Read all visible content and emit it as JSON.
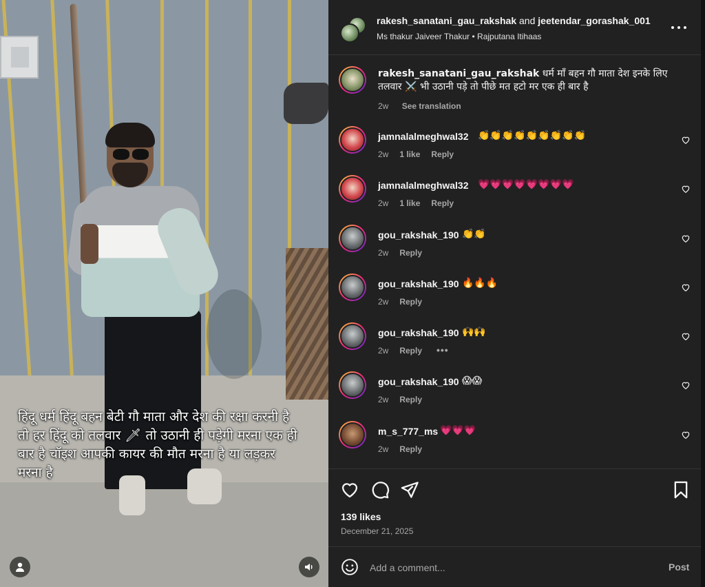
{
  "media": {
    "overlay_text": "हिंदू धर्म हिंदू बहन बेटी गौ माता और देश की रक्षा करनी है तो हर हिंदू को तलवार 🗡 तो उठानी ही पड़ेगी मरना एक ही बार है चॉइश आपकी कायर की मौत मरना है या लड़कर मरना है",
    "icons": [
      "user-tag-icon",
      "audio-icon"
    ]
  },
  "header": {
    "user1": "rakesh_sanatani_gau_rakshak",
    "and": "and",
    "user2": "jeetendar_gorashak_001",
    "subtitle": "Ms thakur Jaiveer Thakur • Rajputana Itihaas",
    "more_icon": "more-options-icon"
  },
  "caption": {
    "username": "rakesh_sanatani_gau_rakshak",
    "text": "धर्म माँ बहन गौ माता देश इनके लिए तलवार ⚔️ भी उठानी पड़े तो पीछे मत हटो मर एक ही बार है",
    "time": "2w",
    "translate": "See translation"
  },
  "comments": [
    {
      "username": "jamnalalmeghwal32",
      "text": "👏👏👏👏👏👏👏👏👏",
      "time": "2w",
      "likes": "1 like",
      "reply": "Reply"
    },
    {
      "username": "jamnalalmeghwal32",
      "text": "💗💗💗💗💗💗💗💗",
      "time": "2w",
      "likes": "1 like",
      "reply": "Reply"
    },
    {
      "username": "gou_rakshak_190",
      "text": "👏👏",
      "time": "2w",
      "likes": "",
      "reply": "Reply"
    },
    {
      "username": "gou_rakshak_190",
      "text": "🔥🔥🔥",
      "time": "2w",
      "likes": "",
      "reply": "Reply"
    },
    {
      "username": "gou_rakshak_190",
      "text": "🙌🙌",
      "time": "2w",
      "likes": "",
      "reply": "Reply",
      "more": "•••"
    },
    {
      "username": "gou_rakshak_190",
      "text": "😱😱",
      "time": "2w",
      "likes": "",
      "reply": "Reply"
    },
    {
      "username": "m_s_777_ms",
      "text": "💗💗💗",
      "time": "2w",
      "likes": "",
      "reply": "Reply"
    }
  ],
  "actions": {
    "icons": [
      "heart-icon",
      "comment-icon",
      "share-icon",
      "bookmark-icon"
    ],
    "likes": "139 likes",
    "date": "December 21, 2025"
  },
  "composer": {
    "placeholder": "Add a comment...",
    "post": "Post",
    "emoji_icon": "emoji-icon"
  }
}
